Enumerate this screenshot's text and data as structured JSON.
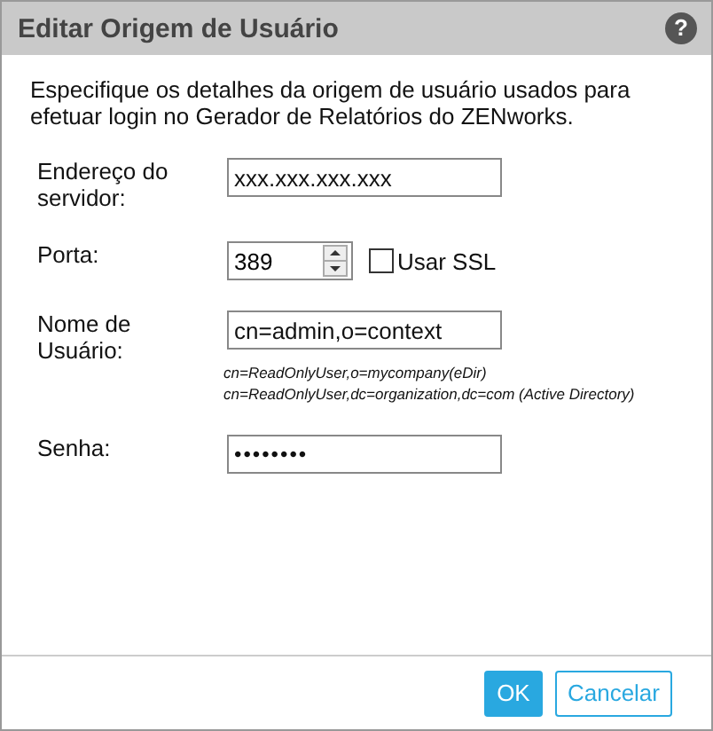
{
  "window": {
    "title": "Editar Origem de Usuário",
    "help": "?"
  },
  "description": "Especifique os detalhes da origem de usuário usados para efetuar login no Gerador de Relatórios do ZENworks.",
  "fields": [
    {
      "kind": "text",
      "label": "Endereço do servidor:",
      "value": "xxx.xxx.xxx.xxx"
    },
    {
      "kind": "spinner",
      "label": "Porta:",
      "value": "389",
      "checkbox": {
        "label": "Usar SSL",
        "checked": false
      }
    },
    {
      "kind": "text",
      "label": "Nome de Usuário:",
      "value": "cn=admin,o=context",
      "hints": [
        "cn=ReadOnlyUser,o=mycompany(eDir)",
        "cn=ReadOnlyUser,dc=organization,dc=com (Active Directory)"
      ]
    },
    {
      "kind": "password",
      "label": "Senha:",
      "value": "••••••••"
    }
  ],
  "buttons": [
    {
      "label": "OK",
      "primary": true
    },
    {
      "label": "Cancelar",
      "primary": false
    }
  ]
}
